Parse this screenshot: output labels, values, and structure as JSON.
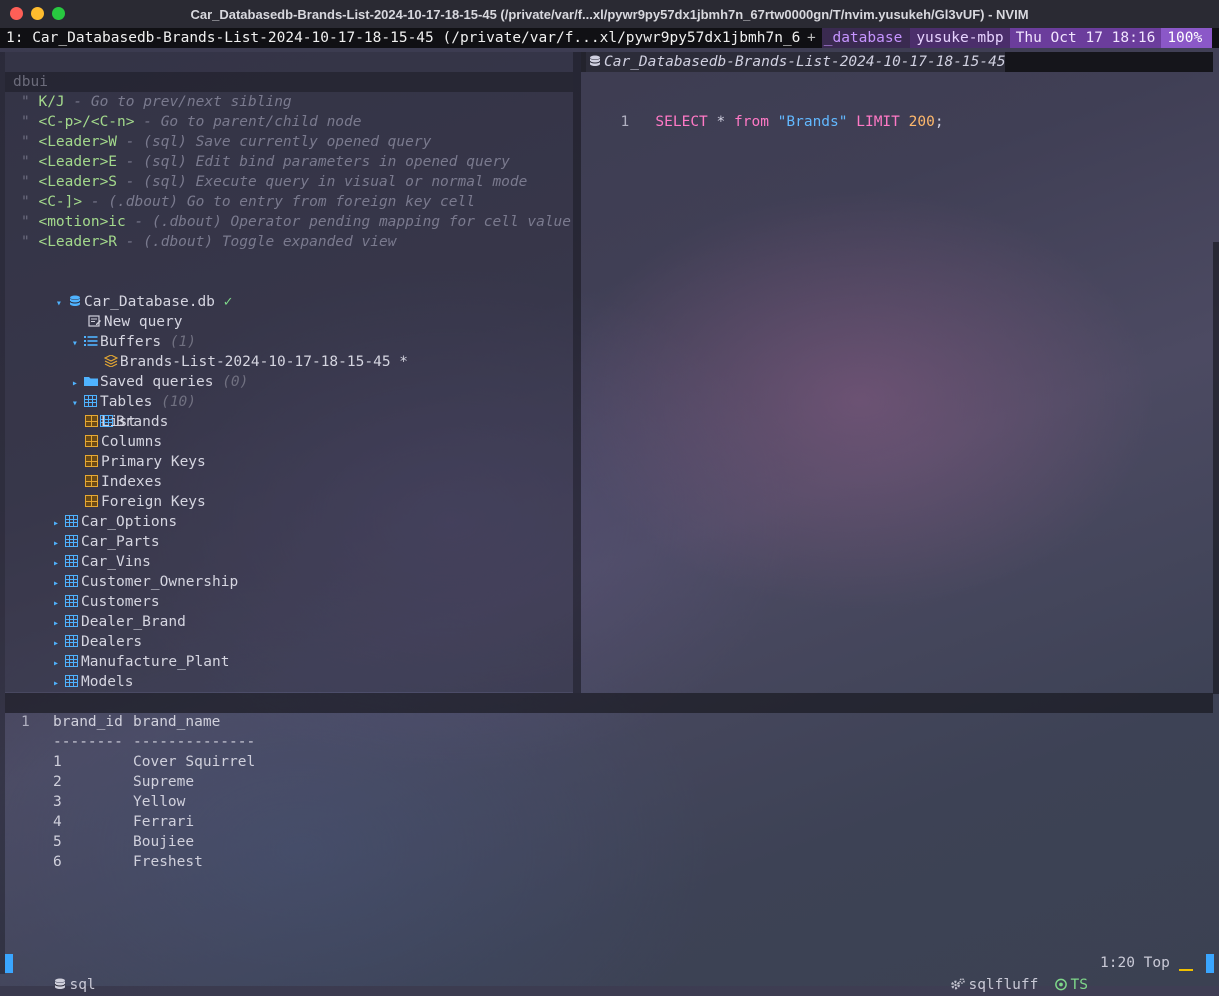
{
  "window": {
    "title": "Car_Databasedb-Brands-List-2024-10-17-18-15-45 (/private/var/f...xl/pywr9py57dx1jbmh7n_67rtw0000gn/T/nvim.yusukeh/Gl3vUF) - NVIM"
  },
  "tmux": {
    "window": "1: Car_Databasedb-Brands-List-2024-10-17-18-15-45 (/private/var/f...xl/pywr9py57dx1jbmh7n_67rtw0000",
    "plus": "+",
    "database": "_database",
    "host": "yusuke-mbp",
    "datetime": "Thu Oct 17 18:16",
    "percent": "100%"
  },
  "dbui": {
    "header": "dbui",
    "help": [
      {
        "key": "K/J",
        "desc": "Go to prev/next sibling"
      },
      {
        "key": "<C-p>/<C-n>",
        "desc": "Go to parent/child node"
      },
      {
        "key": "<Leader>W",
        "desc": "(sql) Save currently opened query"
      },
      {
        "key": "<Leader>E",
        "desc": "(sql) Edit bind parameters in opened query"
      },
      {
        "key": "<Leader>S",
        "desc": "(sql) Execute query in visual or normal mode"
      },
      {
        "key": "<C-]>",
        "desc": "(.dbout) Go to entry from foreign key cell"
      },
      {
        "key": "<motion>ic",
        "desc": "(.dbout) Operator pending mapping for cell value"
      },
      {
        "key": "<Leader>R",
        "desc": "(.dbout) Toggle expanded view"
      }
    ],
    "db_name": "Car_Database.db",
    "db_ok": "✓",
    "new_query": "New query",
    "buffers": {
      "label": "Buffers",
      "count": "(1)"
    },
    "buffer_item": "Brands-List-2024-10-17-18-15-45 *",
    "saved_queries": {
      "label": "Saved queries",
      "count": "(0)"
    },
    "tables": {
      "label": "Tables",
      "count": "(10)"
    },
    "brands": "Brands",
    "brand_sub": [
      "List",
      "Columns",
      "Primary Keys",
      "Indexes",
      "Foreign Keys"
    ],
    "other_tables": [
      "Car_Options",
      "Car_Parts",
      "Car_Vins",
      "Customer_Ownership",
      "Customers",
      "Dealer_Brand",
      "Dealers",
      "Manufacture_Plant",
      "Models"
    ]
  },
  "editor": {
    "tab_title": "Car_Databasedb-Brands-List-2024-10-17-18-15-45",
    "tab_close": "×",
    "line_number": "1",
    "sql": {
      "select": "SELECT",
      "star": "*",
      "from": "from",
      "table": "\"Brands\"",
      "limit": "LIMIT",
      "num": "200",
      "semi": ";"
    }
  },
  "results": {
    "line_number": "1",
    "columns": [
      "brand_id",
      "brand_name"
    ],
    "separators": [
      "--------",
      "--------------"
    ],
    "rows": [
      [
        "1",
        "Cover Squirrel"
      ],
      [
        "2",
        "Supreme"
      ],
      [
        "3",
        "Yellow"
      ],
      [
        "4",
        "Ferrari"
      ],
      [
        "5",
        "Boujiee"
      ],
      [
        "6",
        "Freshest"
      ]
    ]
  },
  "status": {
    "filetype": "sql",
    "linter": "sqlfluff",
    "treesitter": "TS",
    "position": "1:20",
    "scroll": "Top"
  },
  "colors": {
    "accent_blue": "#4fb3ff",
    "help_key": "#a3d98c",
    "sql_keyword": "#ff79c6",
    "sql_string": "#62b8ff",
    "sql_number": "#ffb86c",
    "tmux_purple": "#8b58c8"
  }
}
